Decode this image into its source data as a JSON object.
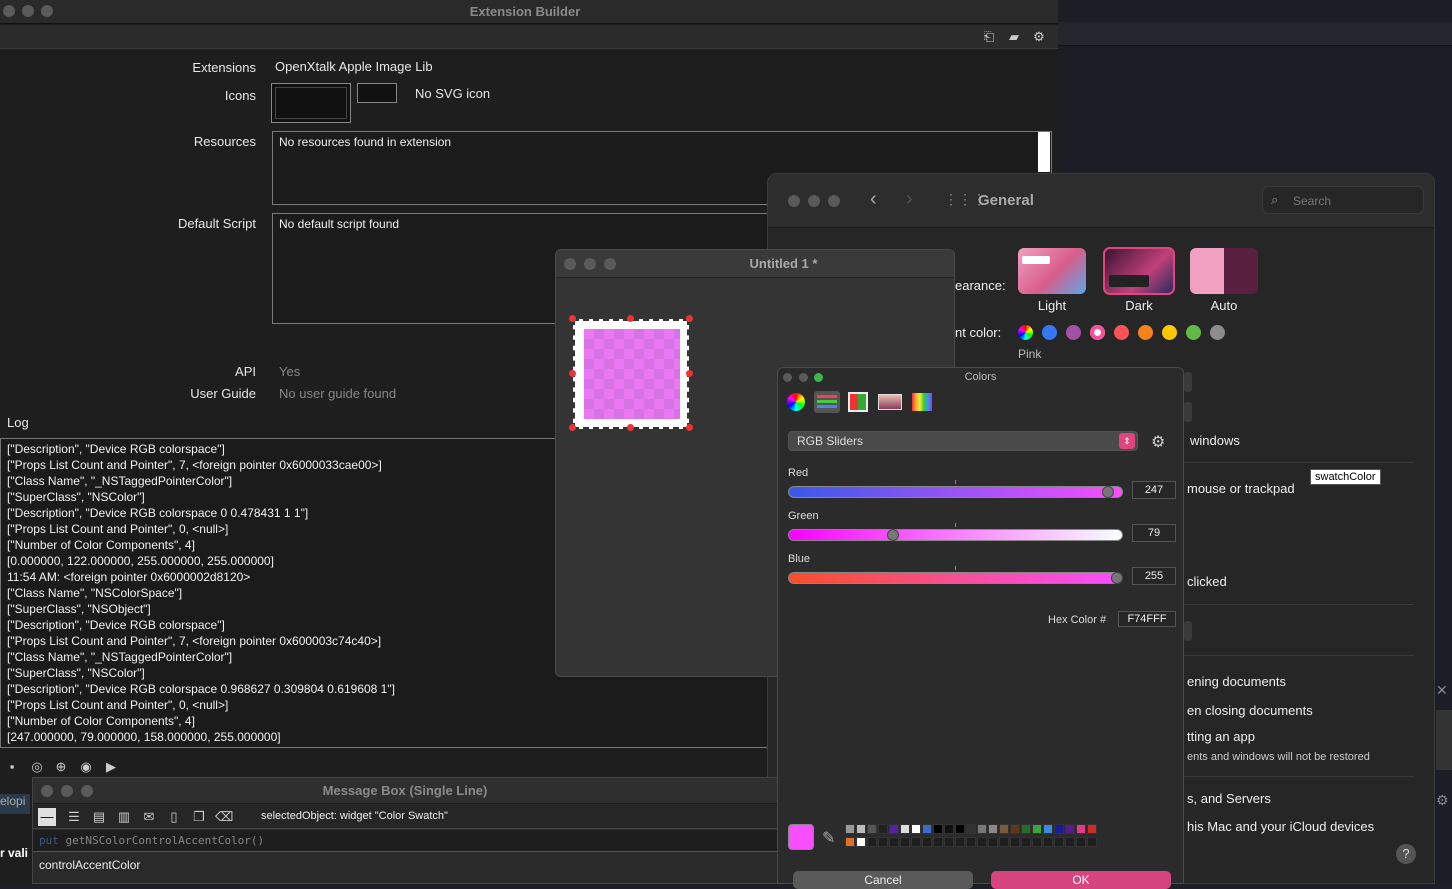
{
  "ext_builder": {
    "title": "Extension Builder",
    "extensions_label": "Extensions",
    "extensions_value": "OpenXtalk Apple Image Lib",
    "icons_label": "Icons",
    "svg_icon_text": "No SVG icon",
    "resources_label": "Resources",
    "resources_value": "No resources found in extension",
    "default_script_label": "Default Script",
    "default_script_value": "No default script found",
    "api_label": "API",
    "api_value": "Yes",
    "user_guide_label": "User Guide",
    "user_guide_value": "No user guide found",
    "log_label": "Log",
    "log_lines": [
      "[\"Description\", \"Device RGB colorspace\"]",
      "[\"Props List Count and Pointer\", 7, <foreign pointer 0x6000033cae00>]",
      "[\"Class Name\", \"_NSTaggedPointerColor\"]",
      "[\"SuperClass\", \"NSColor\"]",
      "[\"Description\", \"Device RGB colorspace 0 0.478431 1 1\"]",
      "[\"Props List Count and Pointer\", 0, <null>]",
      "[\"Number of Color Components\", 4]",
      "[0.000000, 122.000000, 255.000000, 255.000000]",
      "11:54 AM: <foreign pointer 0x6000002d8120>",
      "[\"Class Name\", \"NSColorSpace\"]",
      "[\"SuperClass\", \"NSObject\"]",
      "[\"Description\", \"Device RGB colorspace\"]",
      "[\"Props List Count and Pointer\", 7, <foreign pointer 0x600003c74c40>]",
      "[\"Class Name\", \"_NSTaggedPointerColor\"]",
      "[\"SuperClass\", \"NSColor\"]",
      "[\"Description\", \"Device RGB colorspace 0.968627 0.309804 0.619608 1\"]",
      "[\"Props List Count and Pointer\", 0, <null>]",
      "[\"Number of Color Components\", 4]",
      "[247.000000, 79.000000, 158.000000, 255.000000]"
    ]
  },
  "general": {
    "title": "General",
    "search_placeholder": "Search",
    "appearance_label": "earance:",
    "appearance_options": [
      "Light",
      "Dark",
      "Auto"
    ],
    "accent_label": "nt color:",
    "accent_selected": "Pink",
    "accent_colors": [
      "#888888",
      "#3478f6",
      "#a550a7",
      "#f74f9e",
      "#ff5257",
      "#f7821b",
      "#ffc600",
      "#62ba46",
      "#8c8c8c"
    ],
    "rows": [
      "windows",
      "mouse or trackpad",
      "clicked",
      "ening documents",
      "en closing documents",
      "tting an app",
      "ents and windows will not be restored",
      "s, and Servers",
      "his Mac and your iCloud devices"
    ],
    "help": "?"
  },
  "tooltip": "swatchColor",
  "untitled": {
    "title": "Untitled 1 *",
    "swatch_color": "#f74fff"
  },
  "colors": {
    "title": "Colors",
    "mode": "RGB Sliders",
    "red_label": "Red",
    "red_value": "247",
    "green_label": "Green",
    "green_value": "79",
    "blue_label": "Blue",
    "blue_value": "255",
    "hex_label": "Hex Color #",
    "hex_value": "F74FFF",
    "cancel": "Cancel",
    "ok": "OK",
    "current_color": "#f74fff"
  },
  "message_box": {
    "title": "Message Box (Single Line)",
    "selected_object": "selectedObject: widget \"Color Swatch\"",
    "command_keyword": "put",
    "command_rest": " getNSColorControlAccentColor()",
    "result": "controlAccentColor"
  },
  "left_fragments": {
    "top": "elopi",
    "bottom": "r vali"
  }
}
